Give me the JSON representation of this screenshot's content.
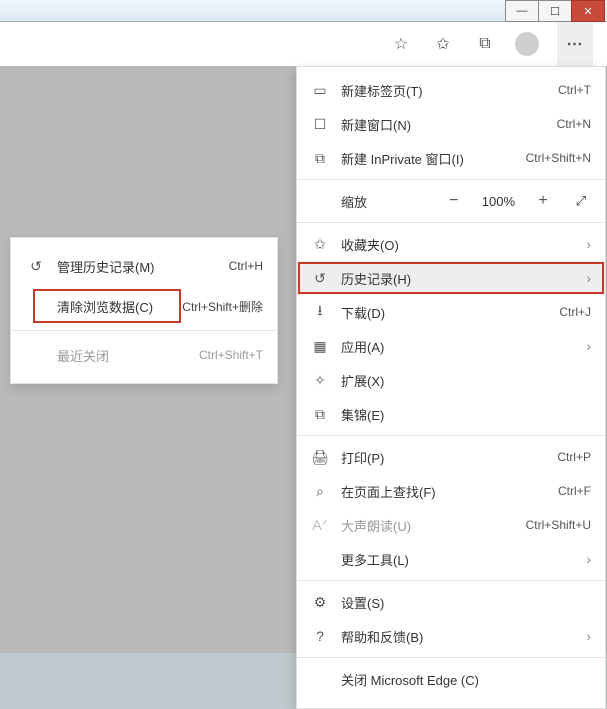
{
  "window": {
    "min": "—",
    "max": "☐",
    "close": "✕"
  },
  "toolbar": {
    "star": "☆",
    "fav": "✩",
    "collections": "⧉",
    "more": "⋯"
  },
  "menu": {
    "new_tab": {
      "icon": "▭",
      "label": "新建标签页(T)",
      "shortcut": "Ctrl+T"
    },
    "new_window": {
      "icon": "☐",
      "label": "新建窗口(N)",
      "shortcut": "Ctrl+N"
    },
    "new_inprivate": {
      "icon": "⧉",
      "label": "新建 InPrivate 窗口(I)",
      "shortcut": "Ctrl+Shift+N"
    },
    "zoom": {
      "label": "缩放",
      "value": "100%",
      "minus": "−",
      "plus": "+",
      "full": "⤢"
    },
    "favorites": {
      "icon": "✩",
      "label": "收藏夹(O)"
    },
    "history": {
      "icon": "↺",
      "label": "历史记录(H)"
    },
    "downloads": {
      "icon": "⭳",
      "label": "下载(D)",
      "shortcut": "Ctrl+J"
    },
    "apps": {
      "icon": "▦",
      "label": "应用(A)"
    },
    "extensions": {
      "icon": "✧",
      "label": "扩展(X)"
    },
    "collections": {
      "icon": "⧉",
      "label": "集锦(E)"
    },
    "print": {
      "icon": "🖨",
      "label": "打印(P)",
      "shortcut": "Ctrl+P"
    },
    "find": {
      "icon": "⌕",
      "label": "在页面上查找(F)",
      "shortcut": "Ctrl+F"
    },
    "readaloud": {
      "icon": "Aᐟ",
      "label": "大声朗读(U)",
      "shortcut": "Ctrl+Shift+U"
    },
    "more_tools": {
      "label": "更多工具(L)"
    },
    "settings": {
      "icon": "⚙",
      "label": "设置(S)"
    },
    "help": {
      "icon": "?",
      "label": "帮助和反馈(B)"
    },
    "close_edge": {
      "label": "关闭 Microsoft Edge (C)"
    }
  },
  "submenu": {
    "manage": {
      "icon": "↺",
      "label": "管理历史记录(M)",
      "shortcut": "Ctrl+H"
    },
    "clear": {
      "label": "清除浏览数据(C)",
      "shortcut": "Ctrl+Shift+删除"
    },
    "recent": {
      "label": "最近关闭",
      "shortcut": "Ctrl+Shift+T"
    }
  },
  "chev": "›"
}
